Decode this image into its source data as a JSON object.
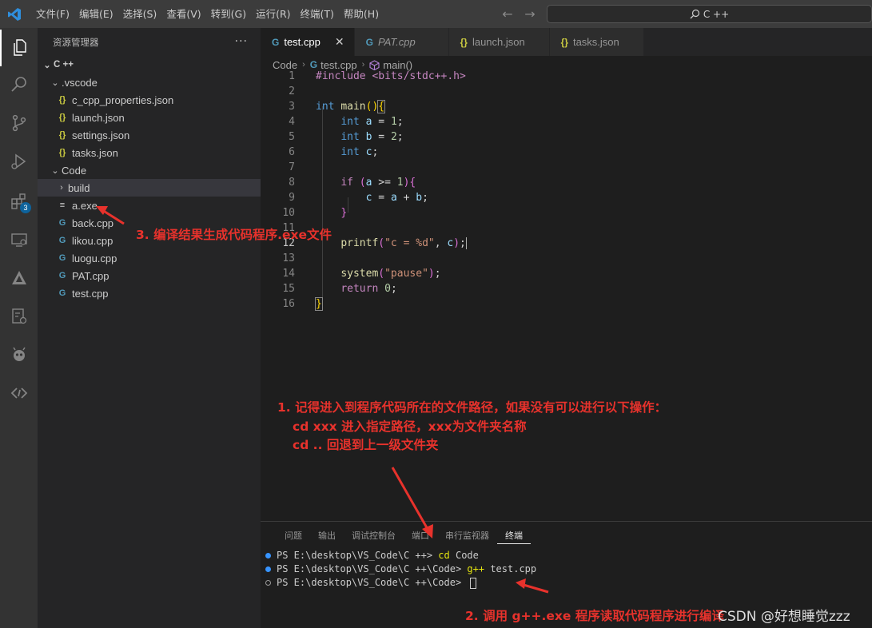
{
  "menu": [
    "文件(F)",
    "编辑(E)",
    "选择(S)",
    "查看(V)",
    "转到(G)",
    "运行(R)",
    "终端(T)",
    "帮助(H)"
  ],
  "command_center": "C ++",
  "activity_badge": "3",
  "explorer": {
    "title": "资源管理器",
    "more": "···",
    "root": "C ++",
    "items": [
      {
        "label": ".vscode",
        "type": "folder"
      },
      {
        "label": "c_cpp_properties.json",
        "type": "json"
      },
      {
        "label": "launch.json",
        "type": "json"
      },
      {
        "label": "settings.json",
        "type": "json"
      },
      {
        "label": "tasks.json",
        "type": "json"
      },
      {
        "label": "Code",
        "type": "folder"
      },
      {
        "label": "build",
        "type": "folder"
      },
      {
        "label": "a.exe",
        "type": "exe"
      },
      {
        "label": "back.cpp",
        "type": "cpp"
      },
      {
        "label": "likou.cpp",
        "type": "cpp"
      },
      {
        "label": "luogu.cpp",
        "type": "cpp"
      },
      {
        "label": "PAT.cpp",
        "type": "cpp"
      },
      {
        "label": "test.cpp",
        "type": "cpp"
      }
    ]
  },
  "tabs": [
    {
      "label": "test.cpp",
      "active": true
    },
    {
      "label": "PAT.cpp",
      "active": false
    },
    {
      "label": "launch.json",
      "active": false
    },
    {
      "label": "tasks.json",
      "active": false
    }
  ],
  "breadcrumbs": [
    "Code",
    "test.cpp",
    "main()"
  ],
  "line_numbers": [
    "1",
    "2",
    "3",
    "4",
    "5",
    "6",
    "7",
    "8",
    "9",
    "10",
    "11",
    "12",
    "13",
    "14",
    "15",
    "16"
  ],
  "code_text": {
    "l1": "#include <bits/stdc++.h>",
    "int": "int",
    "main": "main",
    "a": "a",
    "b": "b",
    "c": "c",
    "one": "1",
    "two": "2",
    "zero": "0",
    "if": "if",
    "printf": "printf",
    "fmt": "\"c = %d\"",
    "system": "system",
    "pause": "\"pause\"",
    "return": "return"
  },
  "panel": {
    "tabs": [
      "问题",
      "输出",
      "调试控制台",
      "端口",
      "串行监视器",
      "终端"
    ],
    "active_tab": "终端",
    "lines": [
      {
        "prompt": "PS E:\\desktop\\VS_Code\\C ++> ",
        "cmd": "cd",
        "args": " Code"
      },
      {
        "prompt": "PS E:\\desktop\\VS_Code\\C ++\\Code> ",
        "cmd": "g++",
        "args": " test.cpp"
      },
      {
        "prompt": "PS E:\\desktop\\VS_Code\\C ++\\Code> ",
        "cmd": "",
        "args": ""
      }
    ]
  },
  "annotations": {
    "a3": "3. 编译结果生成代码程序.exe文件",
    "a1_line1": "1. 记得进入到程序代码所在的文件路径，如果没有可以进行以下操作：",
    "a1_line2": "cd xxx 进入指定路径，xxx为文件夹名称",
    "a1_line3": "cd .. 回退到上一级文件夹",
    "a2": "2. 调用 g++.exe 程序读取代码程序进行编译"
  },
  "watermark": "CSDN @好想睡觉zzz",
  "colors": {
    "annotation": "#e8322c",
    "accent": "#007acc"
  }
}
